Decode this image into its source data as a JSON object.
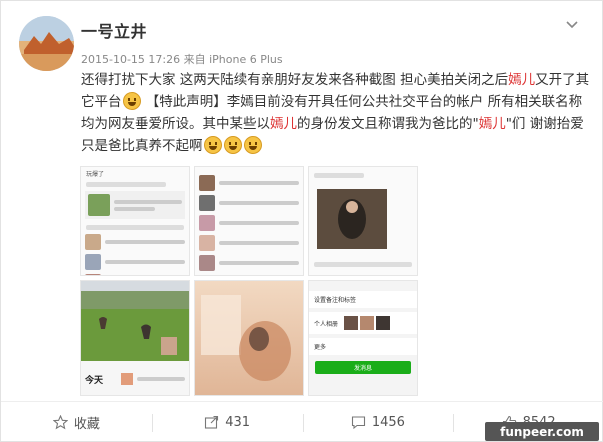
{
  "post": {
    "username": "一号立井",
    "timestamp": "2015-10-15 17:26",
    "source": "来自 iPhone 6 Plus",
    "text": {
      "p1": "还得打扰下大家 这两天陆续有亲朋好友发来各种截图 担心美拍关闭之后",
      "hl1": "嫣儿",
      "p2": "又开了其它平台",
      "p3": " 【特此声明】李嫣目前没有开具任何公共社交平台的帐户 所有相关联名称均为网友垂爱所设。其中某些以",
      "hl2": "嫣儿",
      "p4": "的身份发文且称谓我为爸比的\"",
      "hl3": "嫣儿",
      "p5": "\"们 谢谢抬爱 只是爸比真养不起啊"
    }
  },
  "images": {
    "t1_caption": "玩爆了",
    "t4_caption": "今天",
    "t6_button": "发消息",
    "t6_menu": [
      "设置备注和标签",
      "个人相册",
      "更多"
    ]
  },
  "actions": {
    "favorite_label": "收藏",
    "repost_count": "431",
    "comment_count": "1456",
    "like_count": "8542"
  },
  "watermark": "funpeer.com",
  "colors": {
    "highlight": "#dd3333",
    "text": "#333333",
    "meta": "#888888"
  }
}
